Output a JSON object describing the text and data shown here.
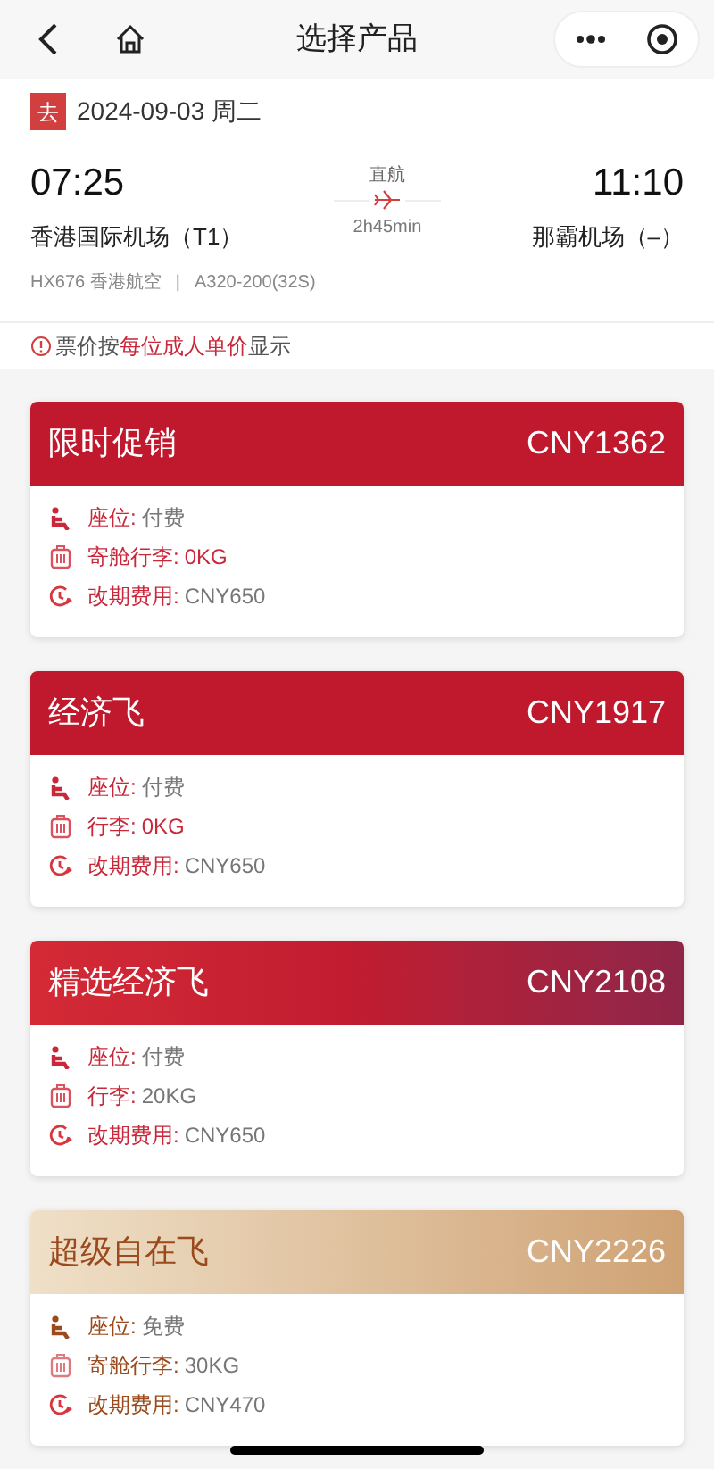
{
  "nav": {
    "title": "选择产品"
  },
  "flight": {
    "direction": "去",
    "date": "2024-09-03 周二",
    "depart_time": "07:25",
    "arrive_time": "11:10",
    "stop_type": "直航",
    "duration": "2h45min",
    "depart_airport": "香港国际机场（T1）",
    "arrive_airport": "那霸机场（–）",
    "flight_no": "HX676 香港航空",
    "separator": "|",
    "aircraft": "A320-200(32S)"
  },
  "notice": "票价按**每位成人单价**显示",
  "products": [
    {
      "kind": "promo",
      "name": "限时促销",
      "price": "CNY1362",
      "rows": [
        {
          "kind": "seat",
          "label": "座位:",
          "value": "付费",
          "highlight": false
        },
        {
          "kind": "bag",
          "label": "寄舱行李:",
          "value": "0KG",
          "highlight": true
        },
        {
          "kind": "change",
          "label": "改期费用:",
          "value": "CNY650",
          "highlight": false
        }
      ]
    },
    {
      "kind": "economy",
      "name": "经济飞",
      "price": "CNY1917",
      "rows": [
        {
          "kind": "seat",
          "label": "座位:",
          "value": "付费",
          "highlight": false
        },
        {
          "kind": "bag",
          "label": "行李:",
          "value": "0KG",
          "highlight": true
        },
        {
          "kind": "change",
          "label": "改期费用:",
          "value": "CNY650",
          "highlight": false
        }
      ]
    },
    {
      "kind": "select",
      "name": "精选经济飞",
      "price": "CNY2108",
      "rows": [
        {
          "kind": "seat",
          "label": "座位:",
          "value": "付费",
          "highlight": false
        },
        {
          "kind": "bag",
          "label": "行李:",
          "value": "20KG",
          "highlight": false
        },
        {
          "kind": "change",
          "label": "改期费用:",
          "value": "CNY650",
          "highlight": false
        }
      ]
    },
    {
      "kind": "super",
      "name": "超级自在飞",
      "price": "CNY2226",
      "rows": [
        {
          "kind": "seat",
          "label": "座位:",
          "value": "免费",
          "highlight": false
        },
        {
          "kind": "bag",
          "label": "寄舱行李:",
          "value": "30KG",
          "highlight": false
        },
        {
          "kind": "change",
          "label": "改期费用:",
          "value": "CNY470",
          "highlight": false
        }
      ]
    }
  ]
}
